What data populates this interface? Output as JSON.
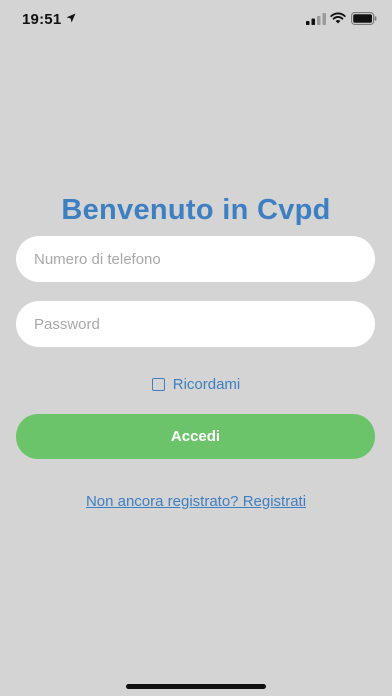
{
  "status_bar": {
    "time": "19:51",
    "icons": [
      "location-arrow-icon",
      "cellular-signal-icon",
      "wifi-icon",
      "battery-icon"
    ]
  },
  "login": {
    "title": "Benvenuto in Cvpd",
    "phone_placeholder": "Numero di telefono",
    "phone_value": "",
    "password_placeholder": "Password",
    "password_value": "",
    "remember_label": "Ricordami",
    "remember_checked": false,
    "submit_label": "Accedi",
    "register_link": "Non ancora registrato? Registrati"
  },
  "colors": {
    "background": "#d4d4d4",
    "accent_blue": "#3e7fc2",
    "button_green": "#6cc46a",
    "field_background": "#ffffff"
  }
}
